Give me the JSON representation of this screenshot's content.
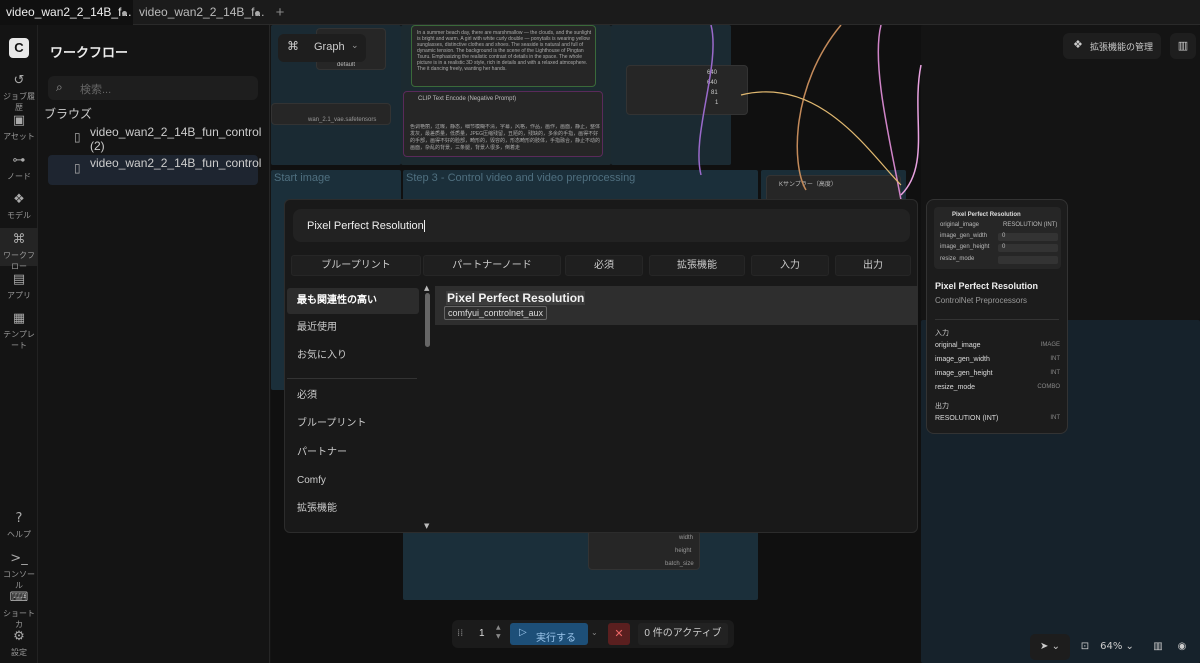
{
  "tabs": [
    {
      "label": "video_wan2_2_14B_f...",
      "active": true
    },
    {
      "label": "video_wan2_2_14B_f...",
      "active": false
    }
  ],
  "new_tab_label": "+",
  "rail": [
    {
      "icon": "history-icon",
      "glyph": "↺",
      "label": "ジョブ履歴"
    },
    {
      "icon": "image-icon",
      "glyph": "▣",
      "label": "アセット"
    },
    {
      "icon": "node-icon",
      "glyph": "⊶",
      "label": "ノード"
    },
    {
      "icon": "puzzle-icon",
      "glyph": "❖",
      "label": "モデル"
    },
    {
      "icon": "workflow-icon",
      "glyph": "⌘",
      "label": "ワークフロー"
    },
    {
      "icon": "apps-icon",
      "glyph": "▤",
      "label": "アプリ"
    },
    {
      "icon": "template-icon",
      "glyph": "▦",
      "label": "テンプレート"
    },
    {
      "icon": "help-icon",
      "glyph": "?",
      "label": "ヘルプ"
    },
    {
      "icon": "console-icon",
      "glyph": ">_",
      "label": "コンソール"
    },
    {
      "icon": "keyboard-icon",
      "glyph": "⌨",
      "label": "ショートカ"
    },
    {
      "icon": "settings-icon",
      "glyph": "⚙",
      "label": "設定"
    }
  ],
  "sidebar": {
    "title": "ワークフロー",
    "search_placeholder": "検索...",
    "browse_label": "ブラウズ",
    "items": [
      {
        "label": "video_wan2_2_14B_fun_control (2)",
        "selected": false
      },
      {
        "label": "video_wan2_2_14B_fun_control",
        "selected": true
      }
    ]
  },
  "canvas": {
    "graph_label": "Graph",
    "extensions_button": "拡張機能の管理",
    "clip_text_encode": "CLIP Text Encode (Negative Prompt)",
    "prompt_text": "In a summer beach day, there are marshmallow — the clouds, and the sunlight is bright and warm. A girl with white curly double — ponytails is wearing yellow sunglasses, distinctive clothes and shoes. The seaside is natural and full of dynamic tension. The background is the scene of the Lighthouse of Pingtan Tsuru. Emphasizing the realistic contrast of details in the space. The whole picture is in a realistic 3D style, rich in details and with a relaxed atmosphere. The it dancing freely, wanting her hands.",
    "negative_text": "色调艳丽，过曝，静态，细节模糊不清，字幕，风格，作品，画作，画面，静止，整体发灰，最差质量，低质量，JPEG压缩残留，丑陋的，残缺的，多余的手指，画得不好的手部，画得不好的脸部，畸形的，毁容的，形态畸形的肢体，手指融合，静止不动的画面，杂乱的背景，三条腿，背景人很多，倒着走",
    "step_title": "Step 3 - Control video and video preprocessing",
    "start_image": "Start image",
    "sampler_label": "Kサンプラー（高度）",
    "vae_file": "wan_2.1_vae.safetensors",
    "widget_values": [
      "640",
      "640",
      "81",
      "1"
    ],
    "lower_outputs": [
      "width",
      "height",
      "batch_size"
    ],
    "default_label": "default"
  },
  "dialog": {
    "search_value": "Pixel Perfect Resolution",
    "filters": [
      "ブループリント",
      "パートナーノード",
      "必須",
      "拡張機能",
      "入力",
      "出力"
    ],
    "categories_top": [
      "最も関連性の高い",
      "最近使用",
      "お気に入り"
    ],
    "categories_bottom": [
      "必須",
      "ブループリント",
      "パートナー",
      "Comfy",
      "拡張機能"
    ],
    "result": {
      "name": "Pixel Perfect Resolution",
      "tag": "comfyui_controlnet_aux"
    }
  },
  "preview": {
    "node_title": "Pixel Perfect Resolution",
    "node_input": "original_image",
    "node_output": "RESOLUTION (INT)",
    "widgets": [
      {
        "name": "image_gen_width",
        "value": "0"
      },
      {
        "name": "image_gen_height",
        "value": "0"
      },
      {
        "name": "resize_mode",
        "value": ""
      }
    ],
    "title": "Pixel Perfect Resolution",
    "category": "ControlNet Preprocessors",
    "inputs_label": "入力",
    "inputs": [
      {
        "name": "original_image",
        "type": "IMAGE"
      },
      {
        "name": "image_gen_width",
        "type": "INT"
      },
      {
        "name": "image_gen_height",
        "type": "INT"
      },
      {
        "name": "resize_mode",
        "type": "COMBO"
      }
    ],
    "outputs_label": "出力",
    "outputs": [
      {
        "name": "RESOLUTION (INT)",
        "type": "INT"
      }
    ]
  },
  "runbar": {
    "batch_count": "1",
    "run_label": "実行する",
    "queue_label": "0 件のアクティブ"
  },
  "bottom_right": {
    "zoom": "64%"
  },
  "colors": {
    "run_button": "#1d4f78",
    "cancel_button": "#5a1f1f",
    "group_teal": "#1f3a48"
  }
}
